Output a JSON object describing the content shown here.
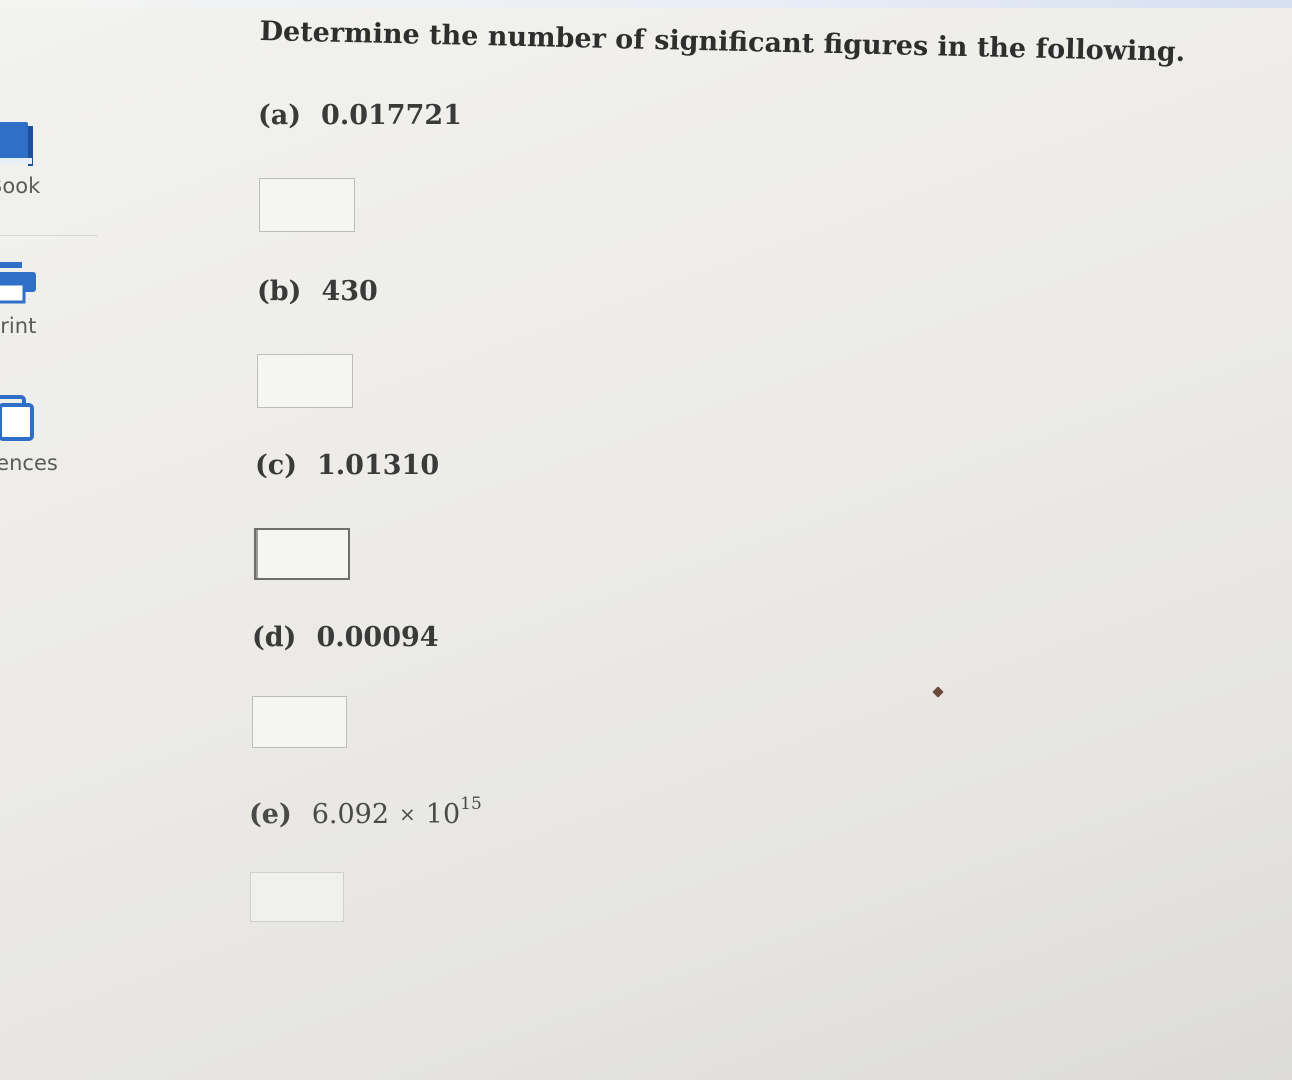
{
  "sidebar": {
    "items": [
      {
        "label": "Book",
        "icon": "book-icon"
      },
      {
        "label": "Print",
        "icon": "printer-icon"
      },
      {
        "label": "rences",
        "icon": "references-icon"
      }
    ]
  },
  "question": {
    "prompt": "Determine the number of significant figures in the following.",
    "parts": [
      {
        "letter": "(a)",
        "value": "0.017721",
        "answer": ""
      },
      {
        "letter": "(b)",
        "value": "430",
        "answer": ""
      },
      {
        "letter": "(c)",
        "value": "1.01310",
        "answer": ""
      },
      {
        "letter": "(d)",
        "value": "0.00094",
        "answer": ""
      },
      {
        "letter": "(e)",
        "mantissa": "6.092",
        "times": "×",
        "base": "10",
        "exponent": "15",
        "answer": ""
      }
    ]
  },
  "colors": {
    "accent_blue": "#2f6fc7",
    "text": "#2e2e2e",
    "background": "#ecebe7"
  }
}
